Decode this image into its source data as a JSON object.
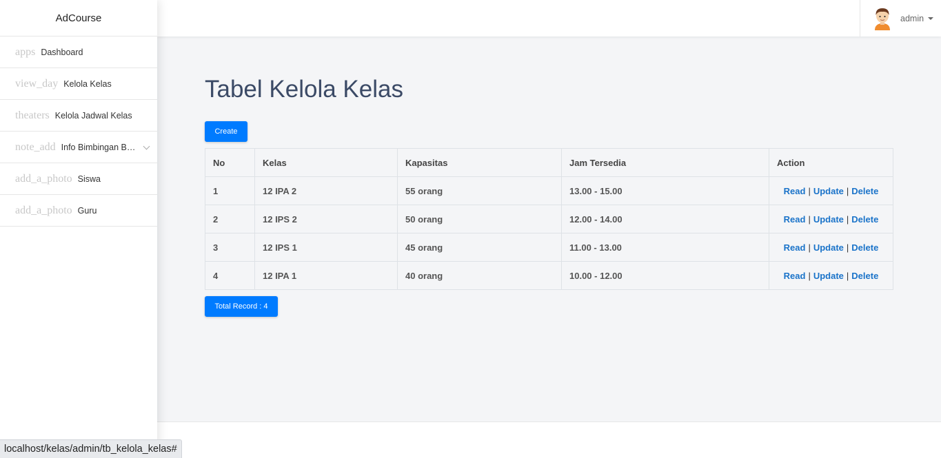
{
  "sidebar": {
    "brand": "AdCourse",
    "items": [
      {
        "icon": "apps",
        "label": "Dashboard"
      },
      {
        "icon": "view_day",
        "label": "Kelola Kelas"
      },
      {
        "icon": "theaters",
        "label": "Kelola Jadwal Kelas"
      },
      {
        "icon": "note_add",
        "label": "Info Bimbingan Belajar"
      },
      {
        "icon": "add_a_photo",
        "label": "Siswa"
      },
      {
        "icon": "add_a_photo",
        "label": "Guru"
      }
    ]
  },
  "topbar": {
    "user_name": "admin"
  },
  "main": {
    "title": "Tabel Kelola Kelas",
    "create_label": "Create",
    "total_label": "Total Record : 4",
    "table": {
      "headers": [
        "No",
        "Kelas",
        "Kapasitas",
        "Jam Tersedia",
        "Action"
      ],
      "rows": [
        {
          "no": "1",
          "kelas": "12 IPA 2",
          "kapasitas": "55 orang",
          "jam": "13.00 - 15.00"
        },
        {
          "no": "2",
          "kelas": "12 IPS 2",
          "kapasitas": "50 orang",
          "jam": "12.00 - 14.00"
        },
        {
          "no": "3",
          "kelas": "12 IPS 1",
          "kapasitas": "45 orang",
          "jam": "11.00 - 13.00"
        },
        {
          "no": "4",
          "kelas": "12 IPA 1",
          "kapasitas": "40 orang",
          "jam": "10.00 - 12.00"
        }
      ],
      "actions": {
        "read": "Read",
        "update": "Update",
        "delete": "Delete",
        "separator": "|"
      }
    }
  },
  "statusbar": {
    "url": "localhost/kelas/admin/tb_kelola_kelas#"
  },
  "colors": {
    "primary": "#007bff",
    "link": "#1a73c9",
    "title": "#3b4a66",
    "background": "#f4f5f7"
  }
}
